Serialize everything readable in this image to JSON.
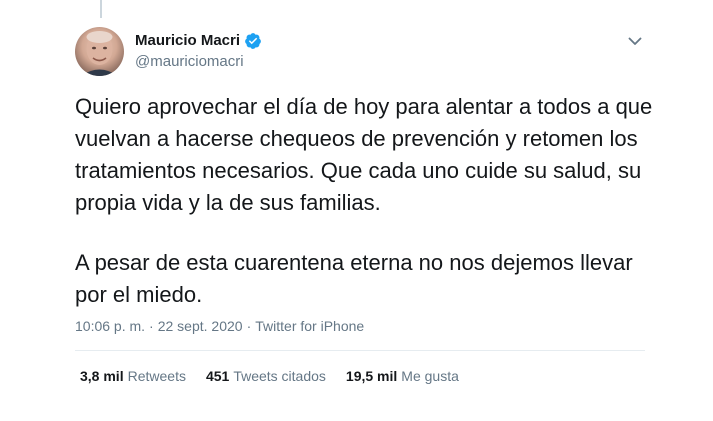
{
  "tweet": {
    "author": {
      "display_name": "Mauricio Macri",
      "handle": "@mauriciomacri",
      "verified": true
    },
    "text_paragraphs": [
      "Quiero aprovechar el día de hoy para alentar a todos a que vuelvan a hacerse chequeos de prevención y retomen los tratamientos necesarios. Que cada uno cuide su salud, su propia vida y la de sus familias.",
      "A pesar de esta cuarentena eterna no nos dejemos llevar por el miedo."
    ],
    "meta": {
      "time": "10:06 p. m.",
      "separator1": "·",
      "date": "22 sept. 2020",
      "separator2": "·",
      "source": "Twitter for iPhone"
    },
    "stats": {
      "retweets_count": "3,8 mil",
      "retweets_label": "Retweets",
      "quotes_count": "451",
      "quotes_label": "Tweets citados",
      "likes_count": "19,5 mil",
      "likes_label": "Me gusta"
    }
  },
  "colors": {
    "verified_blue": "#1da1f2",
    "secondary_text": "#657786",
    "primary_text": "#14171a",
    "divider": "#e6ecf0"
  },
  "icons": {
    "verified": "verified-badge-icon",
    "more": "chevron-down-icon"
  }
}
